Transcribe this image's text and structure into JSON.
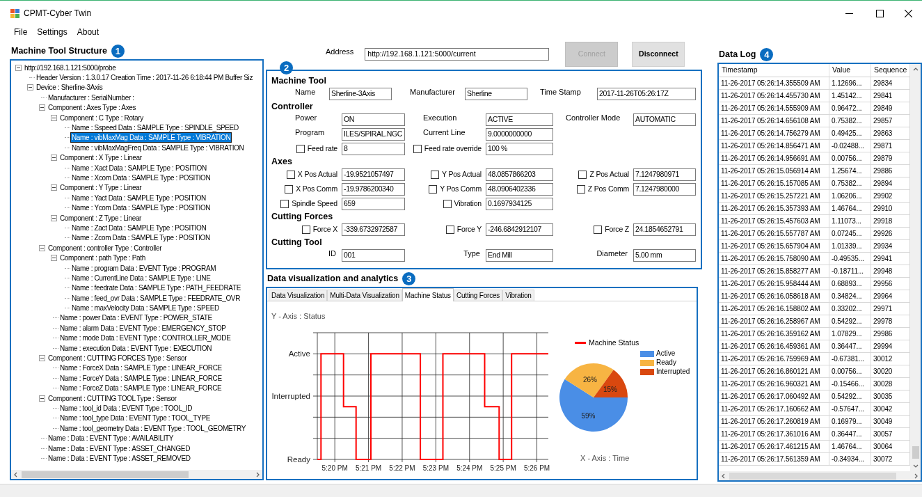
{
  "window": {
    "title": "CPMT-Cyber Twin"
  },
  "menu": [
    "File",
    "Settings",
    "About"
  ],
  "structure": {
    "title": "Machine Tool Structure",
    "badge": "1",
    "tree": [
      {
        "label": "http://192.168.1.121:5000/probe",
        "expanded": true,
        "selected": false,
        "children": [
          {
            "label": "Header Version : 1.3.0.17 Creation Time : 2017-11-26 6:18:44 PM Buffer Siz",
            "selected": false
          },
          {
            "label": "Device : Sherline-3Axis",
            "expanded": true,
            "selected": false,
            "children": [
              {
                "label": "Manufacturer :  SerialNumber :",
                "selected": false
              },
              {
                "label": "Component : Axes Type : Axes",
                "expanded": true,
                "selected": false,
                "children": [
                  {
                    "label": "Component : C Type : Rotary",
                    "expanded": true,
                    "selected": false,
                    "children": [
                      {
                        "label": "Name : Sspeed Data : SAMPLE Type : SPINDLE_SPEED",
                        "selected": false
                      },
                      {
                        "label": "Name : vibMaxMag Data : SAMPLE Type : VIBRATION",
                        "selected": true
                      },
                      {
                        "label": "Name : vibMaxMagFreq Data : SAMPLE Type : VIBRATION",
                        "selected": false
                      }
                    ]
                  },
                  {
                    "label": "Component : X Type : Linear",
                    "expanded": true,
                    "selected": false,
                    "children": [
                      {
                        "label": "Name : Xact Data : SAMPLE Type : POSITION",
                        "selected": false
                      },
                      {
                        "label": "Name : Xcom Data : SAMPLE Type : POSITION",
                        "selected": false
                      }
                    ]
                  },
                  {
                    "label": "Component : Y Type : Linear",
                    "expanded": true,
                    "selected": false,
                    "children": [
                      {
                        "label": "Name : Yact Data : SAMPLE Type : POSITION",
                        "selected": false
                      },
                      {
                        "label": "Name : Ycom Data : SAMPLE Type : POSITION",
                        "selected": false
                      }
                    ]
                  },
                  {
                    "label": "Component : Z Type : Linear",
                    "expanded": true,
                    "selected": false,
                    "children": [
                      {
                        "label": "Name : Zact Data : SAMPLE Type : POSITION",
                        "selected": false
                      },
                      {
                        "label": "Name : Zcom Data : SAMPLE Type : POSITION",
                        "selected": false
                      }
                    ]
                  }
                ]
              },
              {
                "label": "Component : controller Type : Controller",
                "expanded": true,
                "selected": false,
                "children": [
                  {
                    "label": "Component : path Type : Path",
                    "expanded": true,
                    "selected": false,
                    "children": [
                      {
                        "label": "Name : program Data : EVENT Type : PROGRAM",
                        "selected": false
                      },
                      {
                        "label": "Name : CurrentLine Data : SAMPLE Type : LINE",
                        "selected": false
                      },
                      {
                        "label": "Name : feedrate Data : SAMPLE Type : PATH_FEEDRATE",
                        "selected": false
                      },
                      {
                        "label": "Name : feed_ovr Data : SAMPLE Type : FEEDRATE_OVR",
                        "selected": false
                      },
                      {
                        "label": "Name : maxVelocity Data : SAMPLE Type : SPEED",
                        "selected": false
                      }
                    ]
                  },
                  {
                    "label": "Name : power Data : EVENT Type : POWER_STATE",
                    "selected": false
                  },
                  {
                    "label": "Name : alarm Data : EVENT Type : EMERGENCY_STOP",
                    "selected": false
                  },
                  {
                    "label": "Name : mode Data : EVENT Type : CONTROLLER_MODE",
                    "selected": false
                  },
                  {
                    "label": "Name : execution Data : EVENT Type : EXECUTION",
                    "selected": false
                  }
                ]
              },
              {
                "label": "Component : CUTTING FORCES Type : Sensor",
                "expanded": true,
                "selected": false,
                "children": [
                  {
                    "label": "Name : ForceX Data : SAMPLE Type : LINEAR_FORCE",
                    "selected": false
                  },
                  {
                    "label": "Name : ForceY Data : SAMPLE Type : LINEAR_FORCE",
                    "selected": false
                  },
                  {
                    "label": "Name : ForceZ Data : SAMPLE Type : LINEAR_FORCE",
                    "selected": false
                  }
                ]
              },
              {
                "label": "Component : CUTTING TOOL Type : Sensor",
                "expanded": true,
                "selected": false,
                "children": [
                  {
                    "label": "Name : tool_id Data : EVENT Type : TOOL_ID",
                    "selected": false
                  },
                  {
                    "label": "Name : tool_type Data : EVENT Type : TOOL_TYPE",
                    "selected": false
                  },
                  {
                    "label": "Name : tool_geometry Data : EVENT Type : TOOL_GEOMETRY",
                    "selected": false
                  }
                ]
              },
              {
                "label": "Name :  Data : EVENT Type : AVAILABILITY",
                "selected": false
              },
              {
                "label": "Name :  Data : EVENT Type : ASSET_CHANGED",
                "selected": false
              },
              {
                "label": "Name :  Data : EVENT Type : ASSET_REMOVED",
                "selected": false
              }
            ]
          }
        ]
      }
    ]
  },
  "connection": {
    "address_label": "Address",
    "address": "http://192.168.1.121:5000/current",
    "buttons": [
      {
        "label": "Connect",
        "disabled": true
      },
      {
        "label": "Disconnect",
        "disabled": false
      }
    ]
  },
  "machine_panel": {
    "badge": "2",
    "sections": [
      {
        "title": "Machine Tool",
        "rows": [
          [
            {
              "kind": "field",
              "label": "Name",
              "value": "Sherline-3Axis"
            },
            {
              "kind": "field",
              "label": "Manufacturer",
              "value": "Sherline"
            },
            {
              "kind": "field",
              "label": "Time Stamp",
              "value": "2017-11-26T05:26:17Z"
            }
          ]
        ]
      },
      {
        "title": "Controller",
        "rows": [
          [
            {
              "kind": "field",
              "label": "Power",
              "value": "ON"
            },
            {
              "kind": "field",
              "label": "Execution",
              "value": "ACTIVE"
            },
            {
              "kind": "field",
              "label": "Controller Mode",
              "value": "AUTOMATIC"
            }
          ],
          [
            {
              "kind": "field",
              "label": "Program",
              "value": "ILES/SPIRAL.NGC"
            },
            {
              "kind": "field",
              "label": "Current Line",
              "value": "9.0000000000"
            }
          ],
          [
            {
              "kind": "check",
              "label": "Feed rate",
              "checked": false,
              "value": "8"
            },
            {
              "kind": "check",
              "label": "Feed rate override",
              "checked": false,
              "value": "100 %"
            }
          ]
        ]
      },
      {
        "title": "Axes",
        "rows": [
          [
            {
              "kind": "check",
              "label": "X Pos Actual",
              "checked": false,
              "value": "-19.9521057497"
            },
            {
              "kind": "check",
              "label": "Y Pos Actual",
              "checked": false,
              "value": "48.0857866203"
            },
            {
              "kind": "check",
              "label": "Z Pos Actual",
              "checked": false,
              "value": "7.1247980971"
            }
          ],
          [
            {
              "kind": "check",
              "label": "X Pos Comm",
              "checked": false,
              "value": "-19.9786200340"
            },
            {
              "kind": "check",
              "label": "Y Pos Comm",
              "checked": false,
              "value": "48.0906402336"
            },
            {
              "kind": "check",
              "label": "Z Pos Comm",
              "checked": false,
              "value": "7.1247980000"
            }
          ],
          [
            {
              "kind": "check",
              "label": "Spindle Speed",
              "checked": false,
              "value": "659"
            },
            {
              "kind": "check",
              "label": "Vibration",
              "checked": false,
              "value": "0.1697934125"
            }
          ]
        ]
      },
      {
        "title": "Cutting Forces",
        "rows": [
          [
            {
              "kind": "check",
              "label": "Force X",
              "checked": false,
              "value": "-339.6732972587"
            },
            {
              "kind": "check",
              "label": "Force Y",
              "checked": false,
              "value": "-246.6842912107"
            },
            {
              "kind": "check",
              "label": "Force Z",
              "checked": false,
              "value": "24.1854652791"
            }
          ]
        ]
      },
      {
        "title": "Cutting Tool",
        "rows": [
          [
            {
              "kind": "field",
              "label": "ID",
              "value": "001"
            },
            {
              "kind": "field",
              "label": "Type",
              "value": "End Mill"
            },
            {
              "kind": "field",
              "label": "Diameter",
              "value": "5.00 mm"
            }
          ]
        ]
      }
    ]
  },
  "analytics": {
    "title": "Data visualization and analytics",
    "badge": "3",
    "tabs": [
      {
        "label": "Data Visualization",
        "selected": false
      },
      {
        "label": "Multi-Data Visualization",
        "selected": false
      },
      {
        "label": "Machine Status",
        "selected": true
      },
      {
        "label": "Cutting Forces",
        "selected": false
      },
      {
        "label": "Vibration",
        "selected": false
      }
    ],
    "status_chart": {
      "y_axis_title": "Y - Axis : Status",
      "x_axis_title": "X - Axis : Time",
      "legend": "Machine Status",
      "y_labels": [
        "Active",
        "Interrupted",
        "Ready"
      ],
      "x_labels": [
        "5:20 PM",
        "5:21 PM",
        "5:22 PM",
        "5:23 PM",
        "5:24 PM",
        "5:25 PM",
        "5:26 PM"
      ]
    },
    "pie": {
      "chart_data": {
        "type": "pie",
        "categories": [
          "Active",
          "Ready",
          "Interrupted"
        ],
        "values": [
          59,
          26,
          15
        ],
        "colors": [
          "#4a8ee6",
          "#f7b443",
          "#d9480f"
        ],
        "value_labels": [
          "59%",
          "26%",
          "15%"
        ]
      }
    }
  },
  "data_log": {
    "title": "Data Log",
    "badge": "4",
    "columns": [
      "Timestamp",
      "Value",
      "Sequence"
    ],
    "rows": [
      [
        "11-26-2017 05:26:14.355509 AM",
        "1.12696...",
        "29834"
      ],
      [
        "11-26-2017 05:26:14.455730 AM",
        "1.45142...",
        "29841"
      ],
      [
        "11-26-2017 05:26:14.555909 AM",
        "0.96472...",
        "29849"
      ],
      [
        "11-26-2017 05:26:14.656108 AM",
        "0.75382...",
        "29857"
      ],
      [
        "11-26-2017 05:26:14.756279 AM",
        "0.49425...",
        "29863"
      ],
      [
        "11-26-2017 05:26:14.856471 AM",
        "-0.02488...",
        "29871"
      ],
      [
        "11-26-2017 05:26:14.956691 AM",
        "0.00756...",
        "29879"
      ],
      [
        "11-26-2017 05:26:15.056914 AM",
        "1.25674...",
        "29886"
      ],
      [
        "11-26-2017 05:26:15.157085 AM",
        "0.75382...",
        "29894"
      ],
      [
        "11-26-2017 05:26:15.257221 AM",
        "1.06206...",
        "29902"
      ],
      [
        "11-26-2017 05:26:15.357393 AM",
        "1.46764...",
        "29910"
      ],
      [
        "11-26-2017 05:26:15.457603 AM",
        "1.11073...",
        "29918"
      ],
      [
        "11-26-2017 05:26:15.557787 AM",
        "0.07245...",
        "29926"
      ],
      [
        "11-26-2017 05:26:15.657904 AM",
        "1.01339...",
        "29934"
      ],
      [
        "11-26-2017 05:26:15.758090 AM",
        "-0.49535...",
        "29941"
      ],
      [
        "11-26-2017 05:26:15.858277 AM",
        "-0.18711...",
        "29948"
      ],
      [
        "11-26-2017 05:26:15.958444 AM",
        "0.68893...",
        "29956"
      ],
      [
        "11-26-2017 05:26:16.058618 AM",
        "0.34824...",
        "29964"
      ],
      [
        "11-26-2017 05:26:16.158802 AM",
        "0.33202...",
        "29971"
      ],
      [
        "11-26-2017 05:26:16.258967 AM",
        "0.54292...",
        "29978"
      ],
      [
        "11-26-2017 05:26:16.359162 AM",
        "1.07829...",
        "29986"
      ],
      [
        "11-26-2017 05:26:16.459361 AM",
        "0.36447...",
        "29994"
      ],
      [
        "11-26-2017 05:26:16.759969 AM",
        "-0.67381...",
        "30012"
      ],
      [
        "11-26-2017 05:26:16.860121 AM",
        "0.00756...",
        "30020"
      ],
      [
        "11-26-2017 05:26:16.960321 AM",
        "-0.15466...",
        "30028"
      ],
      [
        "11-26-2017 05:26:17.060492 AM",
        "0.54292...",
        "30035"
      ],
      [
        "11-26-2017 05:26:17.160662 AM",
        "-0.57647...",
        "30042"
      ],
      [
        "11-26-2017 05:26:17.260819 AM",
        "0.16979...",
        "30049"
      ],
      [
        "11-26-2017 05:26:17.361016 AM",
        "0.36447...",
        "30057"
      ],
      [
        "11-26-2017 05:26:17.461215 AM",
        "1.46764...",
        "30064"
      ],
      [
        "11-26-2017 05:26:17.561359 AM",
        "-0.34934...",
        "30072"
      ]
    ]
  }
}
